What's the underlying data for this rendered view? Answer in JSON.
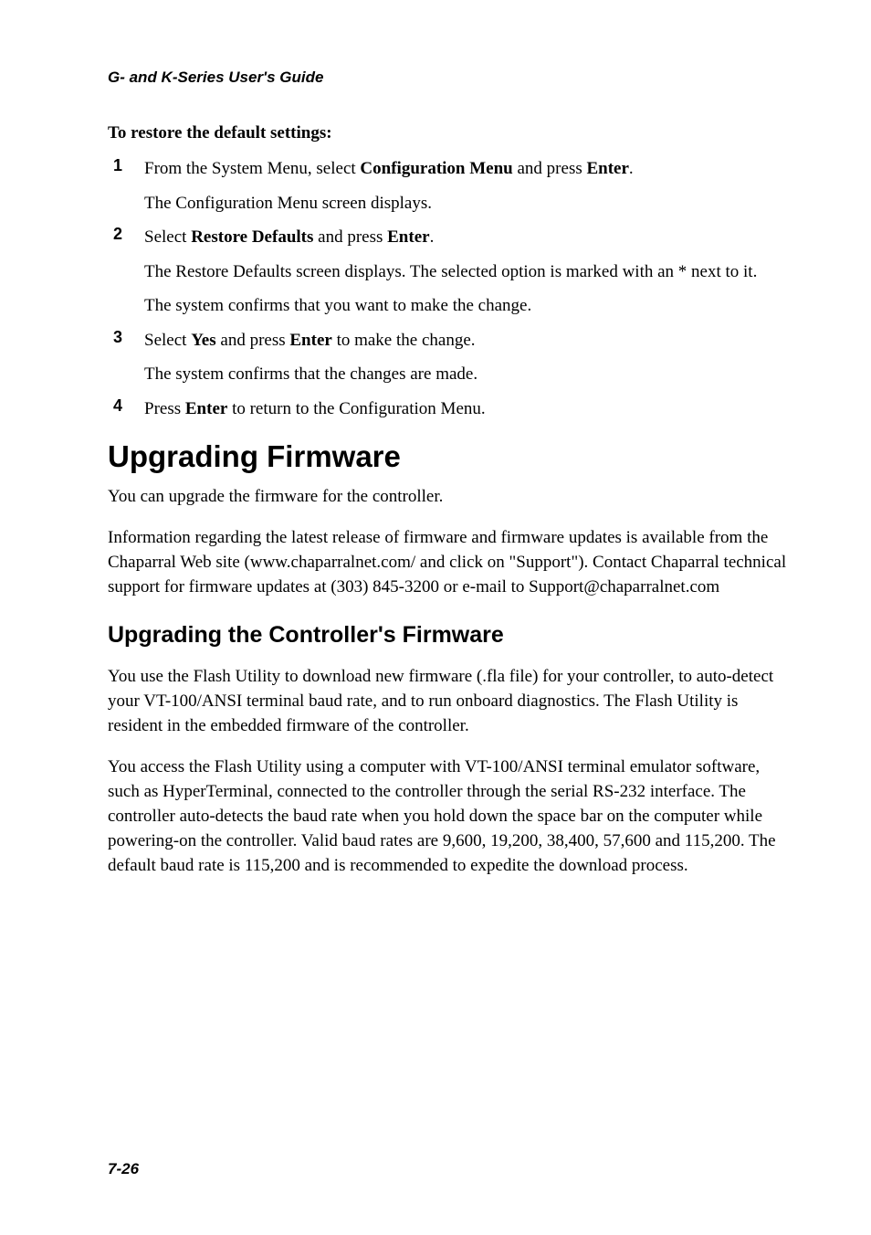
{
  "header": "G- and K-Series User's Guide",
  "section_heading": "To restore the default settings:",
  "steps": [
    {
      "num": "1",
      "lines": [
        {
          "segments": [
            {
              "t": "From the System Menu, select ",
              "b": false
            },
            {
              "t": "Configuration Menu",
              "b": true
            },
            {
              "t": " and press ",
              "b": false
            },
            {
              "t": "Enter",
              "b": true
            },
            {
              "t": ".",
              "b": false
            }
          ]
        },
        {
          "segments": [
            {
              "t": "The Configuration Menu screen displays.",
              "b": false
            }
          ]
        }
      ]
    },
    {
      "num": "2",
      "lines": [
        {
          "segments": [
            {
              "t": "Select ",
              "b": false
            },
            {
              "t": "Restore Defaults",
              "b": true
            },
            {
              "t": " and press ",
              "b": false
            },
            {
              "t": "Enter",
              "b": true
            },
            {
              "t": ".",
              "b": false
            }
          ]
        },
        {
          "segments": [
            {
              "t": "The Restore Defaults screen displays. The selected option is marked with an * next to it.",
              "b": false
            }
          ]
        },
        {
          "segments": [
            {
              "t": "The system confirms that you want to make the change.",
              "b": false
            }
          ]
        }
      ]
    },
    {
      "num": "3",
      "lines": [
        {
          "segments": [
            {
              "t": "Select ",
              "b": false
            },
            {
              "t": "Yes",
              "b": true
            },
            {
              "t": " and press ",
              "b": false
            },
            {
              "t": "Enter",
              "b": true
            },
            {
              "t": " to make the change.",
              "b": false
            }
          ]
        },
        {
          "segments": [
            {
              "t": "The system confirms that the changes are made.",
              "b": false
            }
          ]
        }
      ]
    },
    {
      "num": "4",
      "lines": [
        {
          "segments": [
            {
              "t": "Press ",
              "b": false
            },
            {
              "t": "Enter",
              "b": true
            },
            {
              "t": " to return to the Configuration Menu.",
              "b": false
            }
          ]
        }
      ]
    }
  ],
  "h1": "Upgrading Firmware",
  "para1": "You can upgrade the firmware for the controller.",
  "para2": "Information regarding the latest release of firmware and firmware updates is available from the Chaparral Web site (www.chaparralnet.com/ and click on \"Support\"). Contact Chaparral technical support for firmware updates at (303) 845-3200 or e-mail to Support@chaparralnet.com",
  "h2": "Upgrading the Controller's Firmware",
  "para3": "You use the Flash Utility to download new firmware (.fla file) for your controller, to auto-detect your VT-100/ANSI terminal baud rate, and to run onboard diagnostics. The Flash Utility is resident in the embedded firmware of the controller.",
  "para4": "You access the Flash Utility using a computer with VT-100/ANSI terminal emulator software, such as HyperTerminal, connected to the controller through the serial RS-232 interface. The controller auto-detects the baud rate when you hold down the space bar on the computer while powering-on the controller. Valid baud rates are 9,600, 19,200, 38,400, 57,600 and 115,200. The default baud rate is 115,200 and is recommended to expedite the download process.",
  "page_number": "7-26"
}
